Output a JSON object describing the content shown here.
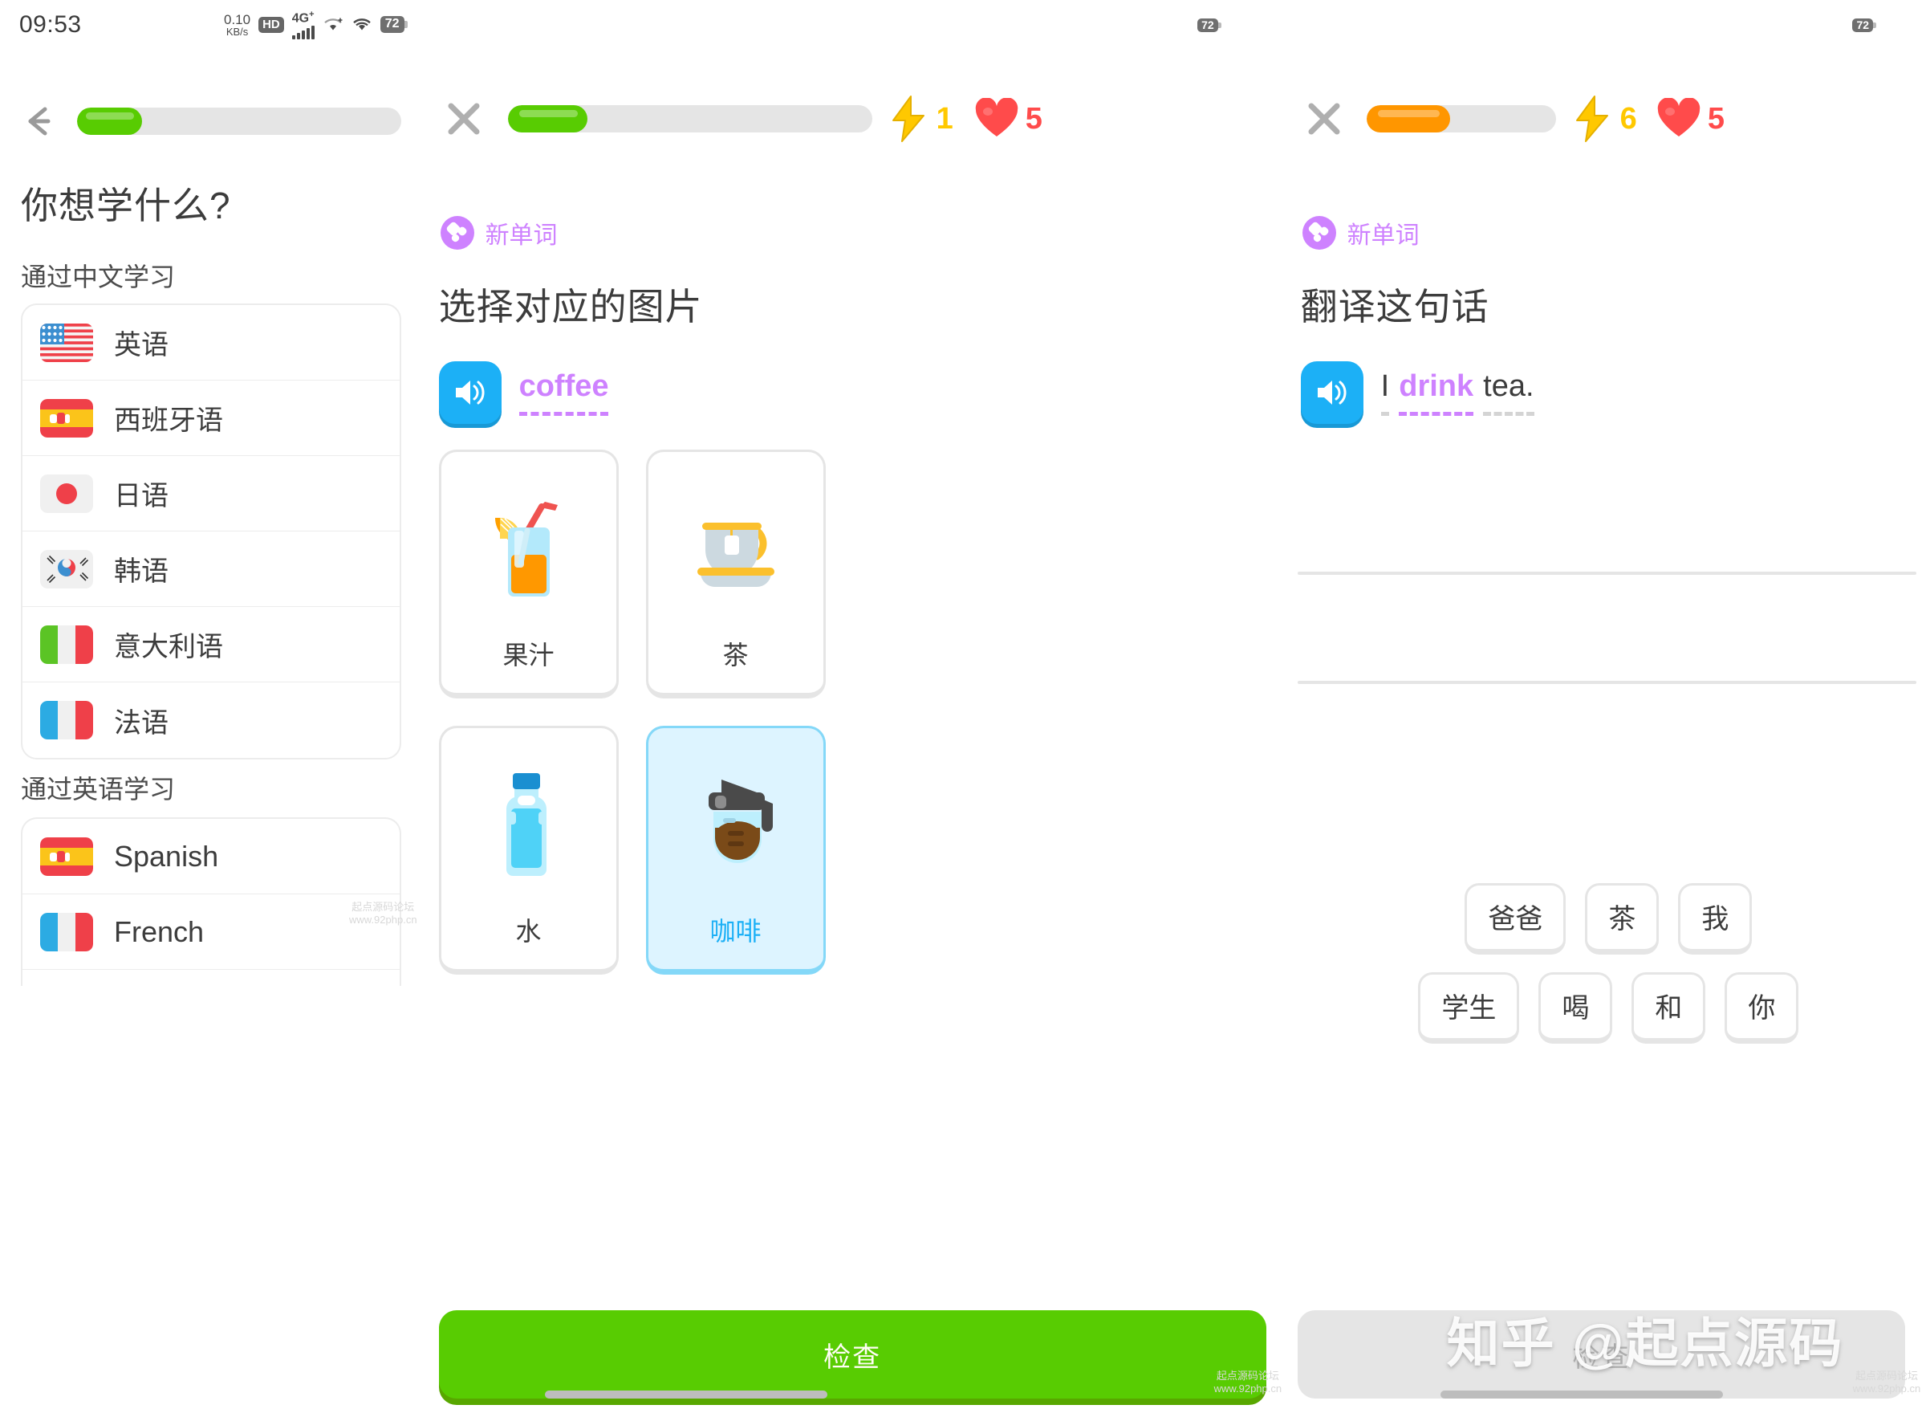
{
  "status_bar": {
    "time": "09:53",
    "net_speed_value": "0.10",
    "net_speed_unit": "KB/s",
    "hd_badge": "HD",
    "network_type": "4G",
    "network_plus": "+",
    "battery_percent": "72"
  },
  "panel1": {
    "name": "language-picker",
    "progress_percent": 20,
    "title": "你想学什么?",
    "section1_label": "通过中文学习",
    "section2_label": "通过英语学习",
    "section1_items": [
      {
        "flag": "us-flag-icon",
        "label": "英语"
      },
      {
        "flag": "es-flag-icon",
        "label": "西班牙语"
      },
      {
        "flag": "jp-flag-icon",
        "label": "日语"
      },
      {
        "flag": "kr-flag-icon",
        "label": "韩语"
      },
      {
        "flag": "it-flag-icon",
        "label": "意大利语"
      },
      {
        "flag": "fr-flag-icon",
        "label": "法语"
      }
    ],
    "section2_items": [
      {
        "flag": "es-flag-icon",
        "label": "Spanish"
      },
      {
        "flag": "fr-flag-icon",
        "label": "French"
      },
      {
        "flag": "de-flag-icon",
        "label": ""
      }
    ]
  },
  "panel2": {
    "name": "select-image-exercise",
    "progress_percent": 22,
    "progress_color": "#58cc02",
    "bolt_count": "1",
    "heart_count": "5",
    "badge_label": "新单词",
    "title": "选择对应的图片",
    "prompt_word": "coffee",
    "options": [
      {
        "art": "juice-glass-icon",
        "label": "果汁",
        "selected": false
      },
      {
        "art": "tea-cup-icon",
        "label": "茶",
        "selected": false
      },
      {
        "art": "water-bottle-icon",
        "label": "水",
        "selected": false
      },
      {
        "art": "coffee-pot-icon",
        "label": "咖啡",
        "selected": true
      }
    ],
    "check_label": "检查"
  },
  "panel3": {
    "name": "translate-exercise",
    "progress_percent": 44,
    "progress_color": "#ff9600",
    "bolt_count": "6",
    "heart_count": "5",
    "badge_label": "新单词",
    "title": "翻译这句话",
    "sentence": [
      {
        "text": "I",
        "highlighted": false
      },
      {
        "text": "drink",
        "highlighted": true
      },
      {
        "text": "tea.",
        "highlighted": false
      }
    ],
    "word_bank_row1": [
      "爸爸",
      "茶",
      "我"
    ],
    "word_bank_row2": [
      "学生",
      "喝",
      "和",
      "你"
    ],
    "check_label": "检查"
  },
  "watermark": {
    "text": "知乎 @起点源码",
    "corner_line1": "起点源码论坛",
    "corner_line2": "www.92php.cn"
  },
  "colors": {
    "green": "#58cc02",
    "orange": "#ff9600",
    "blue": "#1cb0f6",
    "purple": "#ce82ff",
    "red": "#ff4b4b",
    "gold": "#ffc800"
  }
}
